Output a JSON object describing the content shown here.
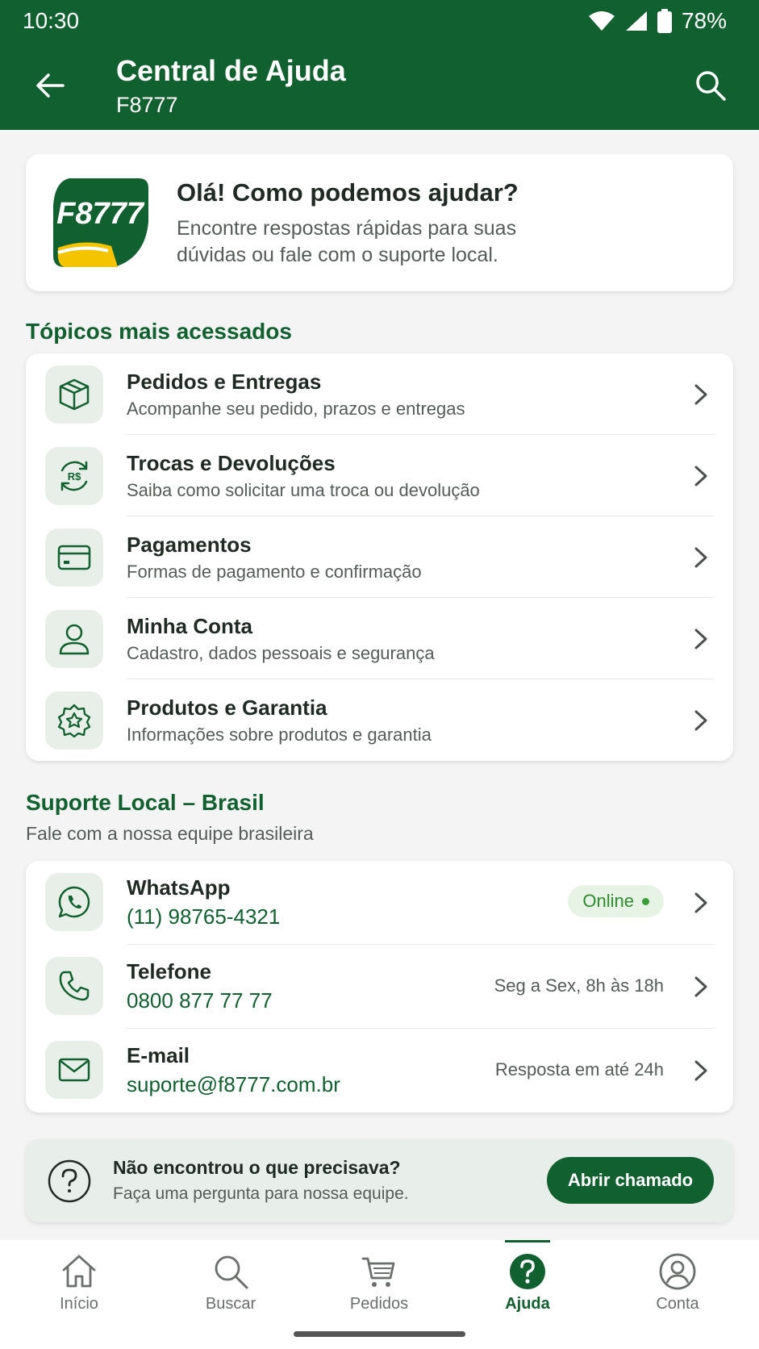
{
  "status_bar": {
    "time": "10:30",
    "battery": "78%"
  },
  "header": {
    "title": "Central de Ajuda",
    "subtitle": "F8777"
  },
  "welcome": {
    "logo_text": "F8777",
    "title": "Olá! Como podemos ajudar?",
    "text": "Encontre respostas rápidas para suas dúvidas ou fale com o suporte local."
  },
  "topics": {
    "title": "Tópicos mais acessados",
    "items": [
      {
        "title": "Pedidos e Entregas",
        "desc": "Acompanhe seu pedido, prazos e entregas",
        "icon": "package-icon"
      },
      {
        "title": "Trocas e Devoluções",
        "desc": "Saiba como solicitar uma troca ou devolução",
        "icon": "exchange-icon",
        "icon_text": "R$"
      },
      {
        "title": "Pagamentos",
        "desc": "Formas de pagamento e confirmação",
        "icon": "credit-card-icon"
      },
      {
        "title": "Minha Conta",
        "desc": "Cadastro, dados pessoais e segurança",
        "icon": "user-icon"
      },
      {
        "title": "Produtos e Garantia",
        "desc": "Informações sobre produtos e garantia",
        "icon": "warranty-badge-icon"
      }
    ]
  },
  "support": {
    "title": "Suporte Local – Brasil",
    "subtitle": "Fale com a nossa equipe brasileira",
    "contacts": [
      {
        "title": "WhatsApp",
        "value": "(11) 98765-4321",
        "badge": "Online",
        "icon": "whatsapp-icon"
      },
      {
        "title": "Telefone",
        "value": "0800 877 77 77",
        "meta": "Seg a Sex, 8h às 18h",
        "icon": "phone-icon"
      },
      {
        "title": "E-mail",
        "value": "suporte@f8777.com.br",
        "meta": "Resposta em até 24h",
        "icon": "mail-icon"
      }
    ]
  },
  "help": {
    "title": "Não encontrou o que precisava?",
    "text": "Faça uma pergunta para nossa equipe.",
    "button": "Abrir chamado"
  },
  "nav": [
    {
      "label": "Início",
      "icon": "home-icon"
    },
    {
      "label": "Buscar",
      "icon": "search-icon"
    },
    {
      "label": "Pedidos",
      "icon": "cart-icon"
    },
    {
      "label": "Ajuda",
      "icon": "help-icon",
      "active": true
    },
    {
      "label": "Conta",
      "icon": "account-icon"
    }
  ],
  "colors": {
    "primary": "#11602f",
    "accent_yellow": "#f5c400",
    "online": "#3a9e38"
  }
}
